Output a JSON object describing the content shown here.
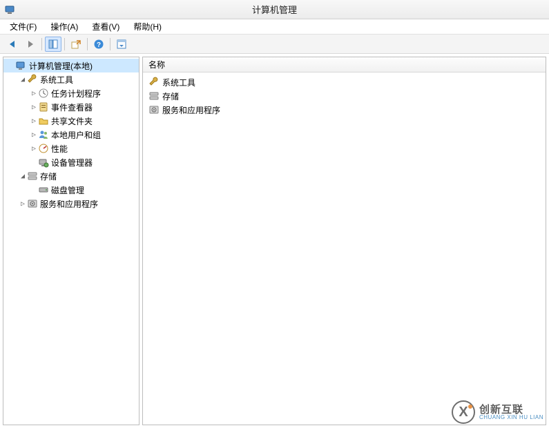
{
  "window": {
    "title": "计算机管理"
  },
  "menu": {
    "file": "文件(F)",
    "action": "操作(A)",
    "view": "查看(V)",
    "help": "帮助(H)"
  },
  "toolbar": {
    "back": "back",
    "forward": "forward",
    "up": "up",
    "show_hide": "show-hide-tree",
    "export": "export-list",
    "help": "help",
    "details": "details-pane"
  },
  "tree": {
    "root": {
      "label": "计算机管理(本地)",
      "icon": "computer-mgmt-icon"
    },
    "system_tools": {
      "label": "系统工具",
      "icon": "wrench-icon",
      "children": {
        "task_scheduler": {
          "label": "任务计划程序",
          "icon": "clock-icon"
        },
        "event_viewer": {
          "label": "事件查看器",
          "icon": "event-icon"
        },
        "shared_folders": {
          "label": "共享文件夹",
          "icon": "folder-share-icon"
        },
        "local_users": {
          "label": "本地用户和组",
          "icon": "users-icon"
        },
        "performance": {
          "label": "性能",
          "icon": "perf-icon"
        },
        "device_manager": {
          "label": "设备管理器",
          "icon": "device-icon"
        }
      }
    },
    "storage": {
      "label": "存储",
      "icon": "storage-icon",
      "children": {
        "disk_mgmt": {
          "label": "磁盘管理",
          "icon": "disk-icon"
        }
      }
    },
    "services_apps": {
      "label": "服务和应用程序",
      "icon": "services-icon"
    }
  },
  "list": {
    "header": "名称",
    "items": [
      {
        "label": "系统工具",
        "icon": "wrench-icon"
      },
      {
        "label": "存储",
        "icon": "storage-icon"
      },
      {
        "label": "服务和应用程序",
        "icon": "services-icon"
      }
    ]
  },
  "watermark": {
    "cn": "创新互联",
    "en": "CHUANG XIN HU LIAN"
  }
}
